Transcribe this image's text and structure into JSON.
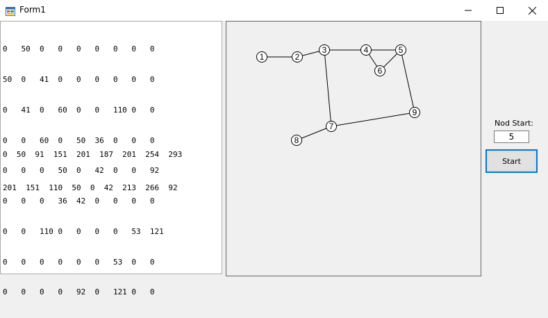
{
  "window": {
    "title": "Form1",
    "icon": "winforms-app-icon",
    "controls": [
      "minimize-icon",
      "maximize-icon",
      "close-icon"
    ]
  },
  "matrix": {
    "rows": [
      "0   50  0   0   0   0   0   0   0",
      "50  0   41  0   0   0   0   0   0",
      "0   41  0   60  0   0   110 0   0",
      "0   0   60  0   50  36  0   0   0",
      "0   0   0   50  0   42  0   0   92",
      "0   0   0   36  42  0   0   0   0",
      "0   0   110 0   0   0   0   53  121",
      "0   0   0   0   0   0   53  0   0",
      "0   0   0   0   92  0   121 0   0"
    ]
  },
  "results": {
    "lines": [
      "0  50  91  151  201  187  201  254  293",
      "201  151  110  50  0  42  213  266  92"
    ]
  },
  "graph": {
    "nodes": [
      {
        "label": "1"
      },
      {
        "label": "2"
      },
      {
        "label": "3"
      },
      {
        "label": "4"
      },
      {
        "label": "5"
      },
      {
        "label": "6"
      },
      {
        "label": "7"
      },
      {
        "label": "8"
      },
      {
        "label": "9"
      }
    ],
    "edges": [
      [
        1,
        2
      ],
      [
        2,
        3
      ],
      [
        3,
        4
      ],
      [
        4,
        5
      ],
      [
        4,
        6
      ],
      [
        5,
        6
      ],
      [
        3,
        7
      ],
      [
        5,
        9
      ],
      [
        7,
        9
      ],
      [
        7,
        8
      ]
    ]
  },
  "controls": {
    "nod_start_label": "Nod Start:",
    "nod_start_value": "5",
    "start_button_label": "Start"
  },
  "colors": {
    "accent": "#0078d7",
    "panel_border": "#646464"
  }
}
